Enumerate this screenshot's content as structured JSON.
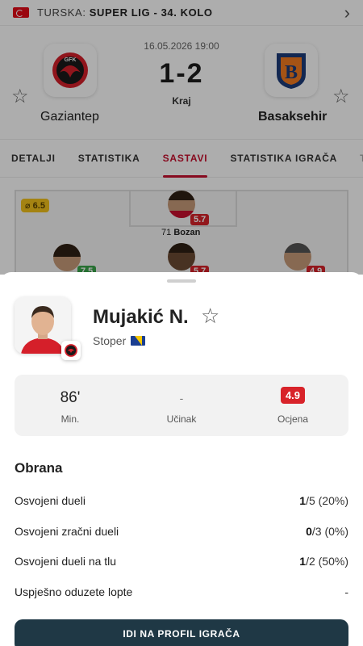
{
  "header": {
    "league_prefix": "TURSKA:",
    "league_name": "SUPER LIG - 34. KOLO"
  },
  "match": {
    "date": "16.05.2026 19:00",
    "score": "1-2",
    "status": "Kraj",
    "home_team": "Gaziantep",
    "home_logo_text": "GFK",
    "away_team": "Basaksehir"
  },
  "tabs": [
    "DETALJI",
    "STATISTIKA",
    "SASTAVI",
    "STATISTIKA IGRAČA",
    "T"
  ],
  "active_tab": "SASTAVI",
  "lineup": {
    "team_rating": "⌀ 6.5",
    "players": [
      {
        "rating": "5.7"
      },
      {
        "rating": "7.5"
      },
      {
        "rating": "5.7"
      },
      {
        "rating": "4.9"
      }
    ],
    "sub_label_number": "71",
    "sub_label_name": "Bozan"
  },
  "player": {
    "name": "Mujakić N.",
    "position": "Stoper"
  },
  "summary": {
    "minutes": "86'",
    "minutes_label": "Min.",
    "impact": "-",
    "impact_label": "Učinak",
    "rating": "4.9",
    "rating_label": "Ocjena"
  },
  "defense": {
    "title": "Obrana",
    "rows": [
      {
        "label": "Osvojeni dueli",
        "value_main": "1",
        "value_rest": "/5 (20%)"
      },
      {
        "label": "Osvojeni zračni dueli",
        "value_main": "0",
        "value_rest": "/3 (0%)"
      },
      {
        "label": "Osvojeni dueli na tlu",
        "value_main": "1",
        "value_rest": "/2 (50%)"
      },
      {
        "label": "Uspješno oduzete lopte",
        "value_main": "",
        "value_rest": "-"
      }
    ]
  },
  "profile_button": "IDI NA PROFIL IGRAČA",
  "colors": {
    "accent": "#c8102e",
    "button": "#1f3845",
    "rating_bad": "#d8232a"
  }
}
